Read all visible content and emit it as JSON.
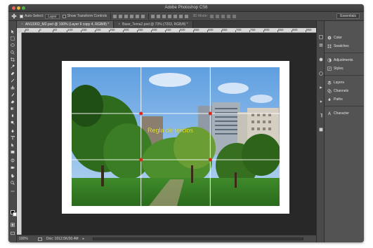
{
  "window": {
    "title": "Adobe Photoshop CS6"
  },
  "options_bar": {
    "auto_select_label": "Auto-Select:",
    "auto_select_value": "Layer",
    "show_transform_label": "Show Transform Controls",
    "mode_3d_label": "3D Mode:",
    "workspace_label": "Essentials"
  },
  "tabs": [
    {
      "label": "AN13302_M2.psd @ 100% (Layer 9 copy 4, RGB/8) *",
      "active": true
    },
    {
      "label": "Base_Tema2.psd @ 73% (7203, RGB/8) *",
      "active": false
    }
  ],
  "ruler": {
    "top_marks": [
      "50",
      "0",
      "50",
      "100",
      "150",
      "200",
      "250",
      "300",
      "350",
      "400",
      "450",
      "500",
      "550",
      "600",
      "650",
      "700",
      "750",
      "800",
      "850",
      "900",
      "950"
    ]
  },
  "canvas": {
    "overlay_text": "Regla de tercios"
  },
  "status": {
    "zoom": "100%",
    "doc_size": "Doc: 1012.5K/30.4M"
  },
  "panels": [
    {
      "label": "Color",
      "icon": "color-wheel-icon"
    },
    {
      "label": "Swatches",
      "icon": "swatches-grid-icon"
    },
    {
      "label": "Adjustments",
      "icon": "adjustments-icon"
    },
    {
      "label": "Styles",
      "icon": "styles-fx-icon"
    },
    {
      "label": "Layers",
      "icon": "layers-stack-icon"
    },
    {
      "label": "Channels",
      "icon": "channels-icon"
    },
    {
      "label": "Paths",
      "icon": "paths-pen-icon"
    },
    {
      "label": "Character",
      "icon": "character-a-icon"
    }
  ],
  "colors": {
    "foreground": "#000000",
    "background": "#ffffff",
    "overlay_text": "#f2ef2e",
    "grid_marker": "#d62a1a"
  }
}
